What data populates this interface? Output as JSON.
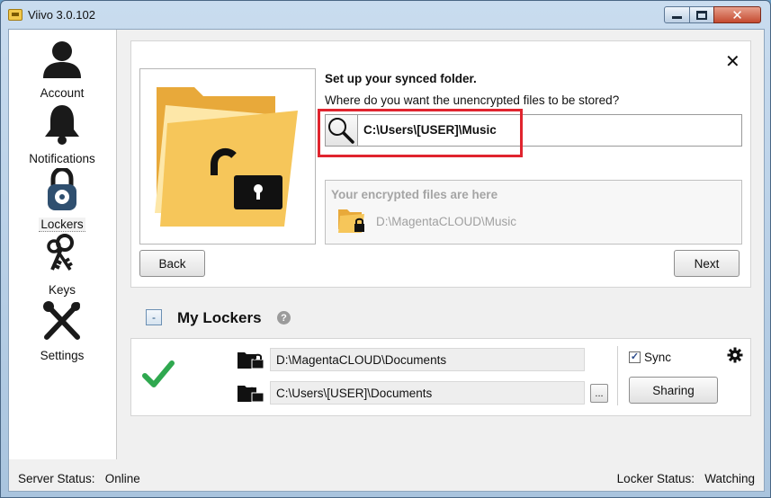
{
  "window": {
    "title": "Viivo 3.0.102"
  },
  "sidebar": {
    "items": [
      {
        "label": "Account",
        "icon": "person-icon"
      },
      {
        "label": "Notifications",
        "icon": "bell-icon"
      },
      {
        "label": "Lockers",
        "icon": "padlock-icon",
        "selected": true
      },
      {
        "label": "Keys",
        "icon": "keys-icon"
      },
      {
        "label": "Settings",
        "icon": "tools-icon"
      }
    ]
  },
  "setup": {
    "heading": "Set up your synced folder.",
    "question": "Where do you want the unencrypted files to be stored?",
    "path_value": "C:\\Users\\[USER]\\Music",
    "encrypted_heading": "Your encrypted files are here",
    "encrypted_path": "D:\\MagentaCLOUD\\Music",
    "back_label": "Back",
    "next_label": "Next",
    "close_label": "✕"
  },
  "lockers": {
    "title": "My Lockers",
    "toggle_label": "-",
    "help_label": "?",
    "items": [
      {
        "encrypted_path": "D:\\MagentaCLOUD\\Documents",
        "decrypted_path": "C:\\Users\\[USER]\\Documents",
        "sync_label": "Sync",
        "sync_checked": true,
        "sharing_label": "Sharing",
        "browse_label": "...",
        "status": "ok"
      }
    ]
  },
  "status": {
    "server": "Server Status:   Online",
    "locker": "Locker Status:   Watching"
  },
  "colors": {
    "highlight": "#e0242e",
    "check": "#2fa84f",
    "folder": "#f4c24a"
  }
}
